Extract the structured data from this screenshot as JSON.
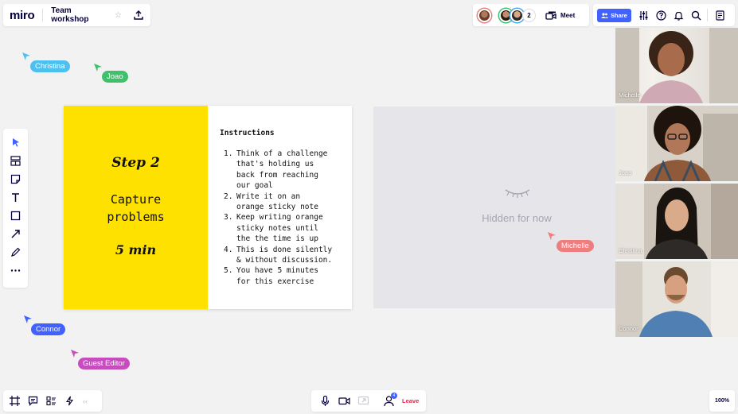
{
  "app": {
    "logo": "miro",
    "board_title": "Team workshop"
  },
  "collaborators": {
    "extra_count": "2",
    "meet_label": "Meet"
  },
  "toolbar": {
    "share_label": "Share"
  },
  "cursors": [
    {
      "name": "Christina",
      "color": "#4dc0f0"
    },
    {
      "name": "Joao",
      "color": "#3ec16a"
    },
    {
      "name": "Michelle",
      "color": "#f07d7d"
    },
    {
      "name": "Connor",
      "color": "#4262ff"
    },
    {
      "name": "Guest Editor",
      "color": "#c64dbd"
    }
  ],
  "step_frame": {
    "step_label": "Step 2",
    "title": "Capture\nproblems",
    "duration": "5 min",
    "instructions_title": "Instructions",
    "instructions": [
      {
        "num": "1.",
        "text": "Think of a challenge\nthat's holding us\nback from reaching\nour goal"
      },
      {
        "num": "2.",
        "text": "Write it on an\norange sticky note"
      },
      {
        "num": "3.",
        "text": "Keep writing orange\nsticky notes until\nthe the time is up"
      },
      {
        "num": "4.",
        "text": "This is done silently\n& without discussion."
      },
      {
        "num": "5.",
        "text": "You have 5 minutes\nfor this exercise"
      }
    ]
  },
  "hidden_frame": {
    "label": "Hidden for now",
    "icon": "closed-eye-icon"
  },
  "videos": [
    {
      "name": "Michelle"
    },
    {
      "name": "Joao"
    },
    {
      "name": "Christina"
    },
    {
      "name": "Connor"
    }
  ],
  "bottom": {
    "leave_label": "Leave",
    "participants_badge": "4",
    "zoom": "100%"
  },
  "colors": {
    "accent": "#4262ff",
    "leave": "#e0294b",
    "sticky_yellow": "#ffe100"
  }
}
